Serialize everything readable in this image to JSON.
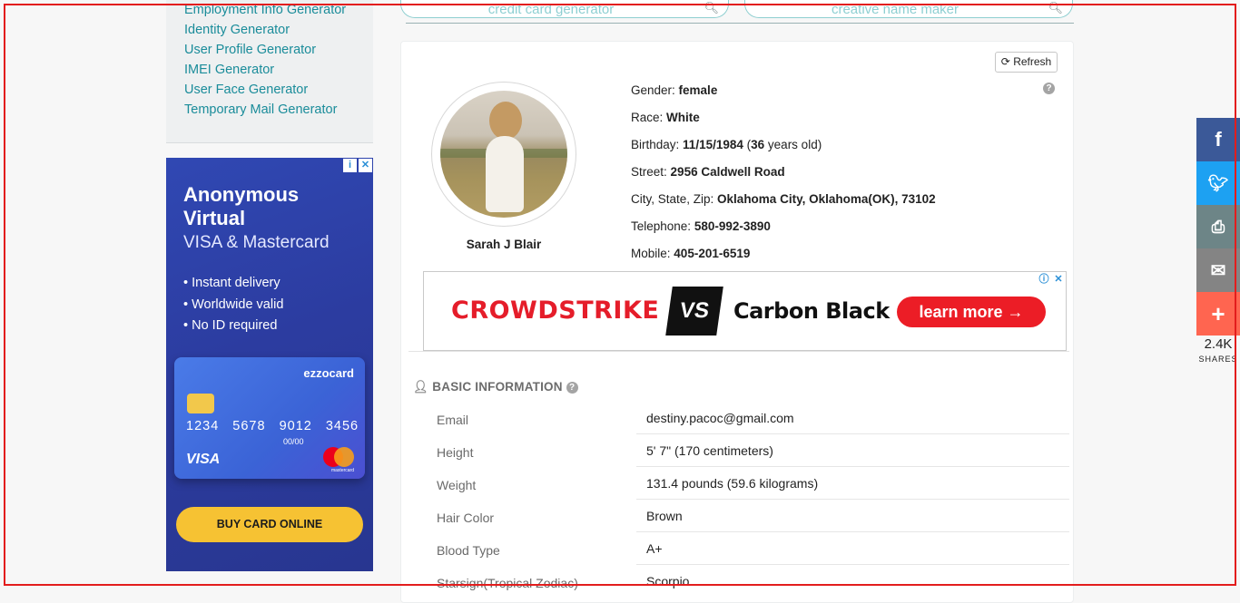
{
  "sidebar": {
    "links": [
      "Employment Info Generator",
      "Identity Generator",
      "User Profile Generator",
      "IMEI Generator",
      "User Face Generator",
      "Temporary Mail Generator"
    ]
  },
  "search": {
    "left_placeholder": "credit card generator",
    "right_placeholder": "creative name maker"
  },
  "ad_left": {
    "headline": "Anonymous Virtual",
    "subheadline": "VISA & Mastercard",
    "bullets": [
      "Instant delivery",
      "Worldwide valid",
      "No ID required"
    ],
    "card_brand": "ezzocard",
    "card_number": "1234 5678 9012 3456",
    "card_expiry": "00/00",
    "card_network": "VISA",
    "card_mc_text": "mastercard",
    "cta": "BUY CARD ONLINE"
  },
  "profile": {
    "refresh_label": "Refresh",
    "name": "Sarah J Blair",
    "gender_label": "Gender:",
    "gender": "female",
    "race_label": "Race:",
    "race": "White",
    "birthday_label": "Birthday:",
    "birthday": "11/15/1984",
    "age": "36",
    "age_suffix": "years old)",
    "street_label": "Street:",
    "street": "2956 Caldwell Road",
    "city_label": "City, State, Zip:",
    "city": "Oklahoma City, Oklahoma(OK), 73102",
    "telephone_label": "Telephone:",
    "telephone": "580-992-3890",
    "mobile_label": "Mobile:",
    "mobile": "405-201-6519"
  },
  "ad_mid": {
    "brand": "CROWDSTRIKE",
    "vs": "VS",
    "competitor": "Carbon Black",
    "cta": "learn more →"
  },
  "basic_info": {
    "title": "BASIC INFORMATION",
    "rows": [
      {
        "label": "Email",
        "value": "destiny.pacoc@gmail.com"
      },
      {
        "label": "Height",
        "value": "5' 7\" (170 centimeters)"
      },
      {
        "label": "Weight",
        "value": "131.4 pounds (59.6 kilograms)"
      },
      {
        "label": "Hair Color",
        "value": "Brown"
      },
      {
        "label": "Blood Type",
        "value": "A+"
      },
      {
        "label": "Starsign(Tropical Zodiac)",
        "value": "Scorpio"
      }
    ]
  },
  "share": {
    "count": "2.4K",
    "label": "SHARES",
    "colors": {
      "facebook": "#3b5998",
      "twitter": "#1da1f2",
      "print": "#6d8587",
      "email": "#848484",
      "more": "#ff6550"
    }
  }
}
